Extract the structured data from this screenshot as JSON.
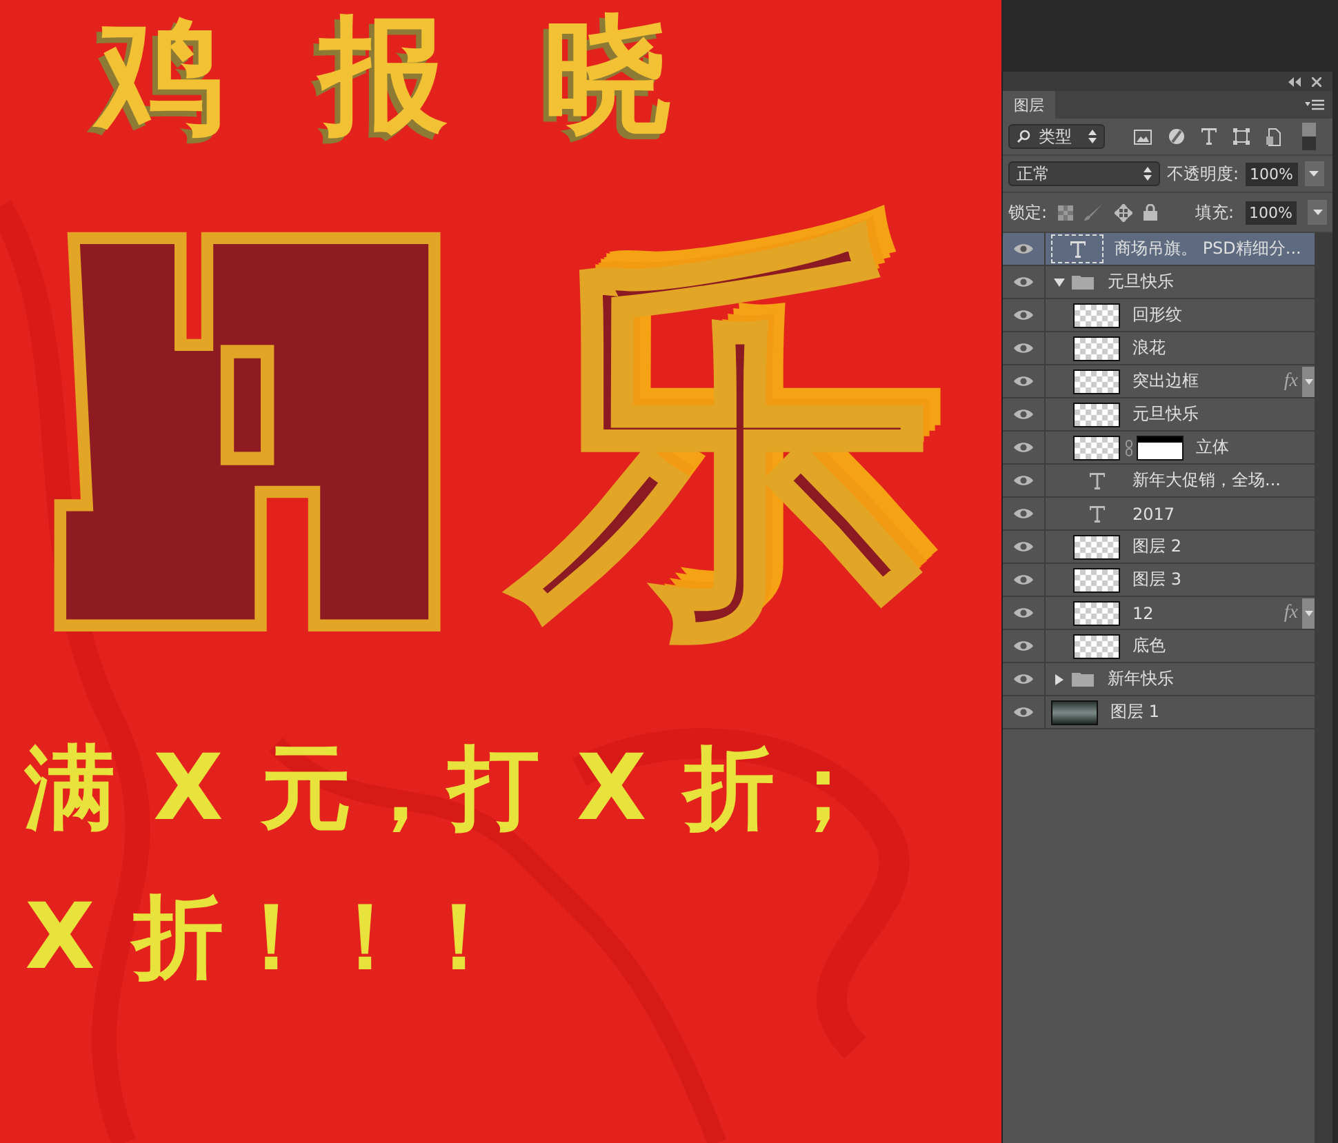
{
  "canvas": {
    "title_fragment": "鸡报晓",
    "headline": "乐",
    "promo_lines": [
      "满 X 元，打 X 折；",
      "X 折！！！"
    ]
  },
  "panel": {
    "tab": "图层",
    "filter": "类型",
    "blend_mode": "正常",
    "opacity_label": "不透明度:",
    "opacity": "100%",
    "lock_label": "锁定:",
    "fill_label": "填充:",
    "fill": "100%"
  },
  "layers": [
    {
      "name": "商场吊旗。 PSD精细分...",
      "kind": "text",
      "selected": true,
      "visible": true
    },
    {
      "name": "元旦快乐",
      "kind": "group",
      "expanded": true,
      "selected": false,
      "visible": true,
      "children": [
        {
          "name": "回形纹",
          "kind": "pixel",
          "selected": false,
          "visible": true
        },
        {
          "name": "浪花",
          "kind": "pixel",
          "selected": false,
          "visible": true
        },
        {
          "name": "突出边框",
          "kind": "pixel",
          "selected": false,
          "visible": true,
          "effects": "fx"
        },
        {
          "name": "元旦快乐",
          "kind": "pixel",
          "selected": false,
          "visible": true
        },
        {
          "name": "立体",
          "kind": "pixel",
          "selected": false,
          "visible": true,
          "mask": true
        },
        {
          "name": "新年大促销，全场...",
          "kind": "text",
          "selected": false,
          "visible": true
        },
        {
          "name": "2017",
          "kind": "text",
          "selected": false,
          "visible": true
        },
        {
          "name": "图层 2",
          "kind": "pixel",
          "selected": false,
          "visible": true
        },
        {
          "name": "图层 3",
          "kind": "pixel",
          "selected": false,
          "visible": true
        },
        {
          "name": "12",
          "kind": "pixel",
          "selected": false,
          "visible": true,
          "effects": "fx"
        },
        {
          "name": "底色",
          "kind": "pixel",
          "selected": false,
          "visible": true
        }
      ]
    },
    {
      "name": "新年快乐",
      "kind": "group",
      "expanded": false,
      "selected": false,
      "visible": true
    },
    {
      "name": "图层 1",
      "kind": "fill",
      "selected": false,
      "visible": true
    }
  ]
}
